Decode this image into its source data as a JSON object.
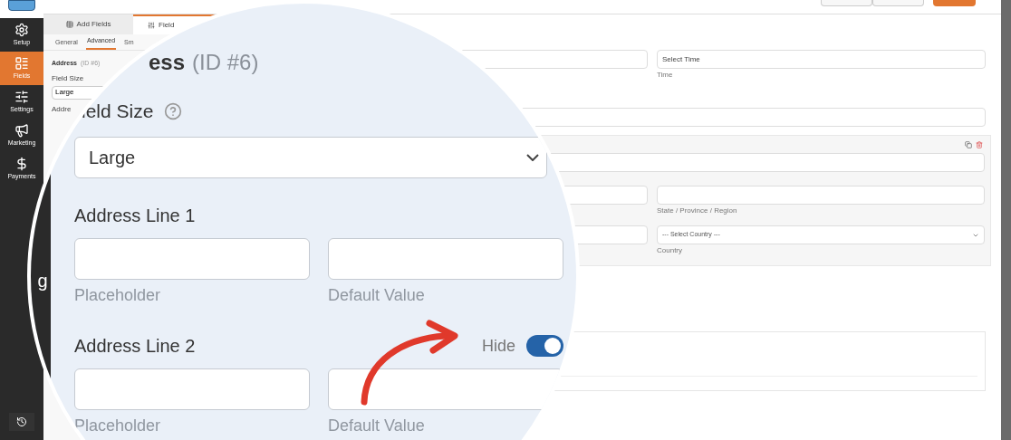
{
  "sidebar": {
    "items": [
      {
        "label": "Setup",
        "selected": false
      },
      {
        "label": "Fields",
        "selected": true
      },
      {
        "label": "Settings",
        "selected": false
      },
      {
        "label": "Marketing",
        "selected": false
      },
      {
        "label": "Payments",
        "selected": false
      }
    ]
  },
  "panel": {
    "tabs": [
      {
        "label": "Add Fields",
        "selected": false
      },
      {
        "label": "Field",
        "selected": true
      }
    ],
    "subtabs": [
      {
        "label": "General",
        "selected": false
      },
      {
        "label": "Advanced",
        "selected": true
      },
      {
        "label": "Sm",
        "selected": false
      }
    ],
    "field_title": "Address",
    "field_id": "(ID #6)",
    "field_size_label": "Field Size",
    "field_size_value": "Large",
    "next_label": "Addre"
  },
  "preview": {
    "time_placeholder": "Select Time",
    "time_label": "Time",
    "state_label": "State / Province / Region",
    "country_placeholder": "--- Select Country ---",
    "country_label": "Country"
  },
  "magnifier": {
    "sidebar_fragment": "g",
    "title": "ess",
    "title_id": "(ID #6)",
    "field_size_label": "ield Size",
    "field_size_value": "Large",
    "lines": [
      {
        "label": "Address Line 1",
        "captions": [
          "Placeholder",
          "Default Value"
        ]
      },
      {
        "label": "Address Line 2",
        "hide": {
          "label": "Hide",
          "on": true
        },
        "captions": [
          "Placeholder",
          "Default Value"
        ]
      }
    ]
  }
}
